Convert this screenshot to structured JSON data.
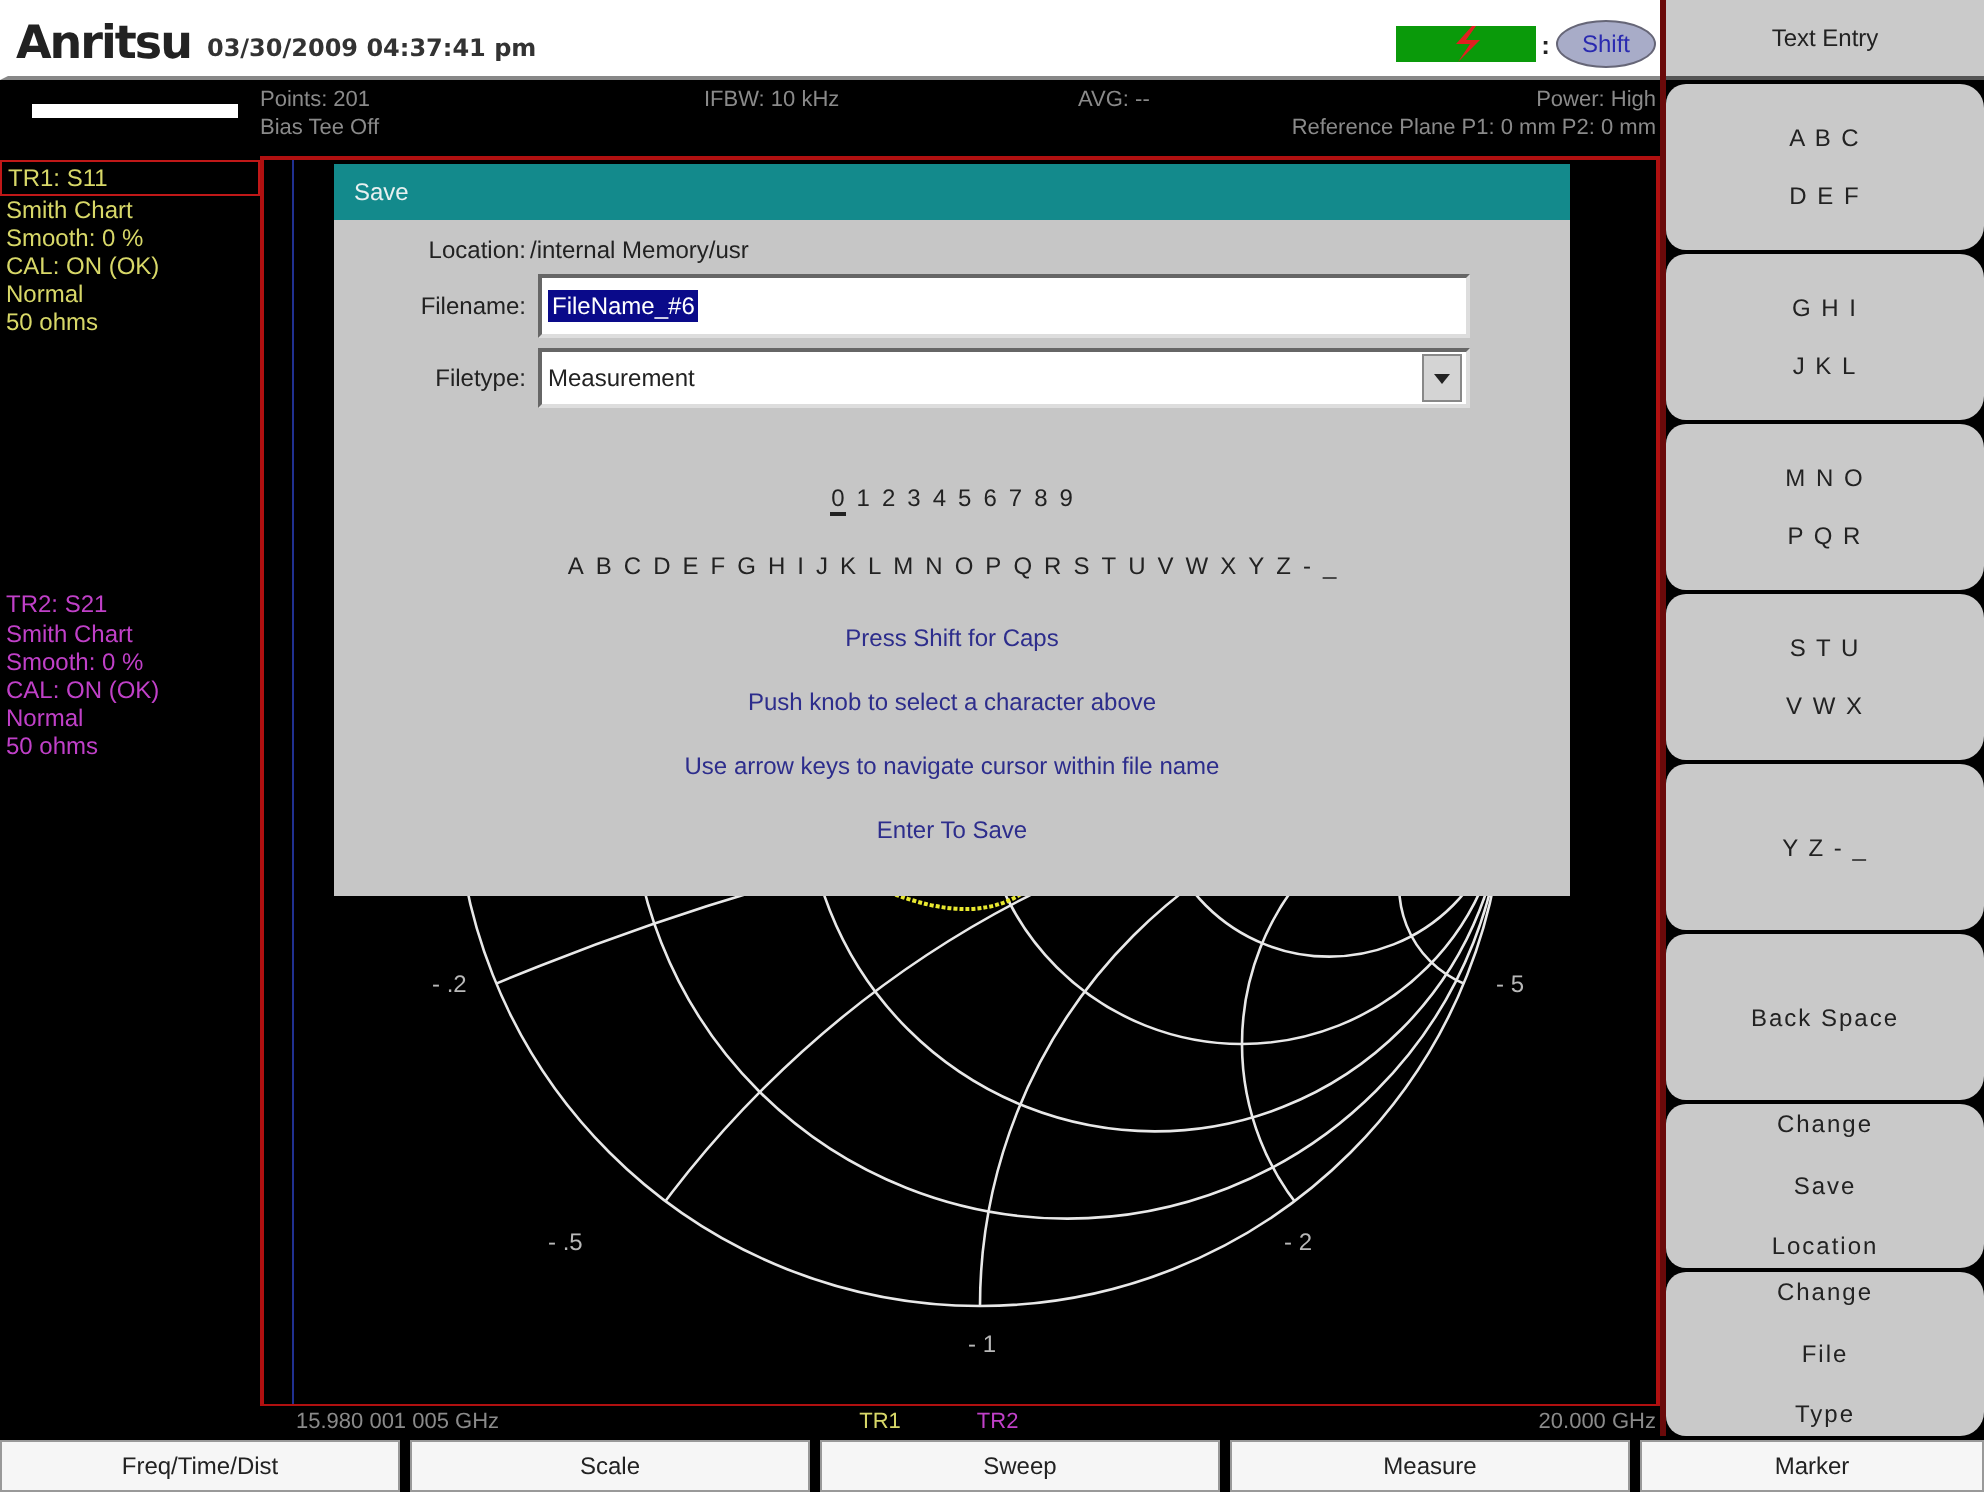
{
  "header": {
    "logo": "Anritsu",
    "datetime": "03/30/2009 04:37:41 pm",
    "separator": ":",
    "shift": "Shift"
  },
  "status": {
    "points": "Points: 201",
    "bias_tee": "Bias Tee Off",
    "ifbw": "IFBW: 10 kHz",
    "avg": "AVG: --",
    "power": "Power: High",
    "reference_plane": "Reference Plane P1: 0 mm P2: 0 mm"
  },
  "traces": [
    {
      "selected": true,
      "color": "#d8d868",
      "lines": [
        "TR1: S11",
        "Smith Chart",
        "Smooth: 0 %",
        "CAL: ON (OK)",
        "Normal",
        "50 ohms"
      ]
    },
    {
      "selected": false,
      "color": "#c040c8",
      "lines": [
        "TR2: S21",
        "Smith Chart",
        "Smooth: 0 %",
        "CAL: ON (OK)",
        "Normal",
        "50 ohms"
      ]
    }
  ],
  "chart": {
    "labels": [
      "- .2",
      "- .5",
      "- 1",
      "- 2",
      "- 5"
    ],
    "start_freq": "15.980 001 005 GHz",
    "stop_freq": "20.000 GHz",
    "trace_keys": [
      {
        "label": "TR1",
        "color": "#d8d868"
      },
      {
        "label": "TR2",
        "color": "#c040c8"
      }
    ]
  },
  "dialog": {
    "title": "Save",
    "location_label": "Location:",
    "location": "/internal Memory/usr",
    "filename_label": "Filename:",
    "filename": "FileName_#6",
    "filename_selected": true,
    "filetype_label": "Filetype:",
    "filetype": "Measurement",
    "char_rows": [
      [
        {
          "char": "0",
          "selected": true
        },
        {
          "char": "1",
          "selected": false
        },
        {
          "char": "2",
          "selected": false
        },
        {
          "char": "3",
          "selected": false
        },
        {
          "char": "4",
          "selected": false
        },
        {
          "char": "5",
          "selected": false
        },
        {
          "char": "6",
          "selected": false
        },
        {
          "char": "7",
          "selected": false
        },
        {
          "char": "8",
          "selected": false
        },
        {
          "char": "9",
          "selected": false
        }
      ],
      [
        {
          "char": "A",
          "selected": false
        },
        {
          "char": "B",
          "selected": false
        },
        {
          "char": "C",
          "selected": false
        },
        {
          "char": "D",
          "selected": false
        },
        {
          "char": "E",
          "selected": false
        },
        {
          "char": "F",
          "selected": false
        },
        {
          "char": "G",
          "selected": false
        },
        {
          "char": "H",
          "selected": false
        },
        {
          "char": "I",
          "selected": false
        },
        {
          "char": "J",
          "selected": false
        },
        {
          "char": "K",
          "selected": false
        },
        {
          "char": "L",
          "selected": false
        },
        {
          "char": "M",
          "selected": false
        },
        {
          "char": "N",
          "selected": false
        },
        {
          "char": "O",
          "selected": false
        },
        {
          "char": "P",
          "selected": false
        },
        {
          "char": "Q",
          "selected": false
        },
        {
          "char": "R",
          "selected": false
        },
        {
          "char": "S",
          "selected": false
        },
        {
          "char": "T",
          "selected": false
        },
        {
          "char": "U",
          "selected": false
        },
        {
          "char": "V",
          "selected": false
        },
        {
          "char": "W",
          "selected": false
        },
        {
          "char": "X",
          "selected": false
        },
        {
          "char": "Y",
          "selected": false
        },
        {
          "char": "Z",
          "selected": false
        },
        {
          "char": "-",
          "selected": false
        },
        {
          "char": "_",
          "selected": false
        }
      ]
    ],
    "hints": [
      "Press Shift for Caps",
      "Push knob to select a character above",
      "Use arrow keys to navigate cursor within file name",
      "Enter To Save"
    ]
  },
  "softkeys": {
    "title": "Text Entry",
    "keys": [
      {
        "lines": [
          "A B C",
          "D E F"
        ]
      },
      {
        "lines": [
          "G H I",
          "J K L"
        ]
      },
      {
        "lines": [
          "M N O",
          "P Q R"
        ]
      },
      {
        "lines": [
          "S T U",
          "V W X"
        ]
      },
      {
        "lines": [
          "Y Z - _"
        ]
      },
      {
        "lines": [
          "Back Space"
        ]
      },
      {
        "lines": [
          "Change",
          "Save",
          "Location"
        ]
      },
      {
        "lines": [
          "Change",
          "File",
          "Type"
        ]
      }
    ]
  },
  "menu": [
    "Freq/Time/Dist",
    "Scale",
    "Sweep",
    "Measure",
    "Marker"
  ]
}
